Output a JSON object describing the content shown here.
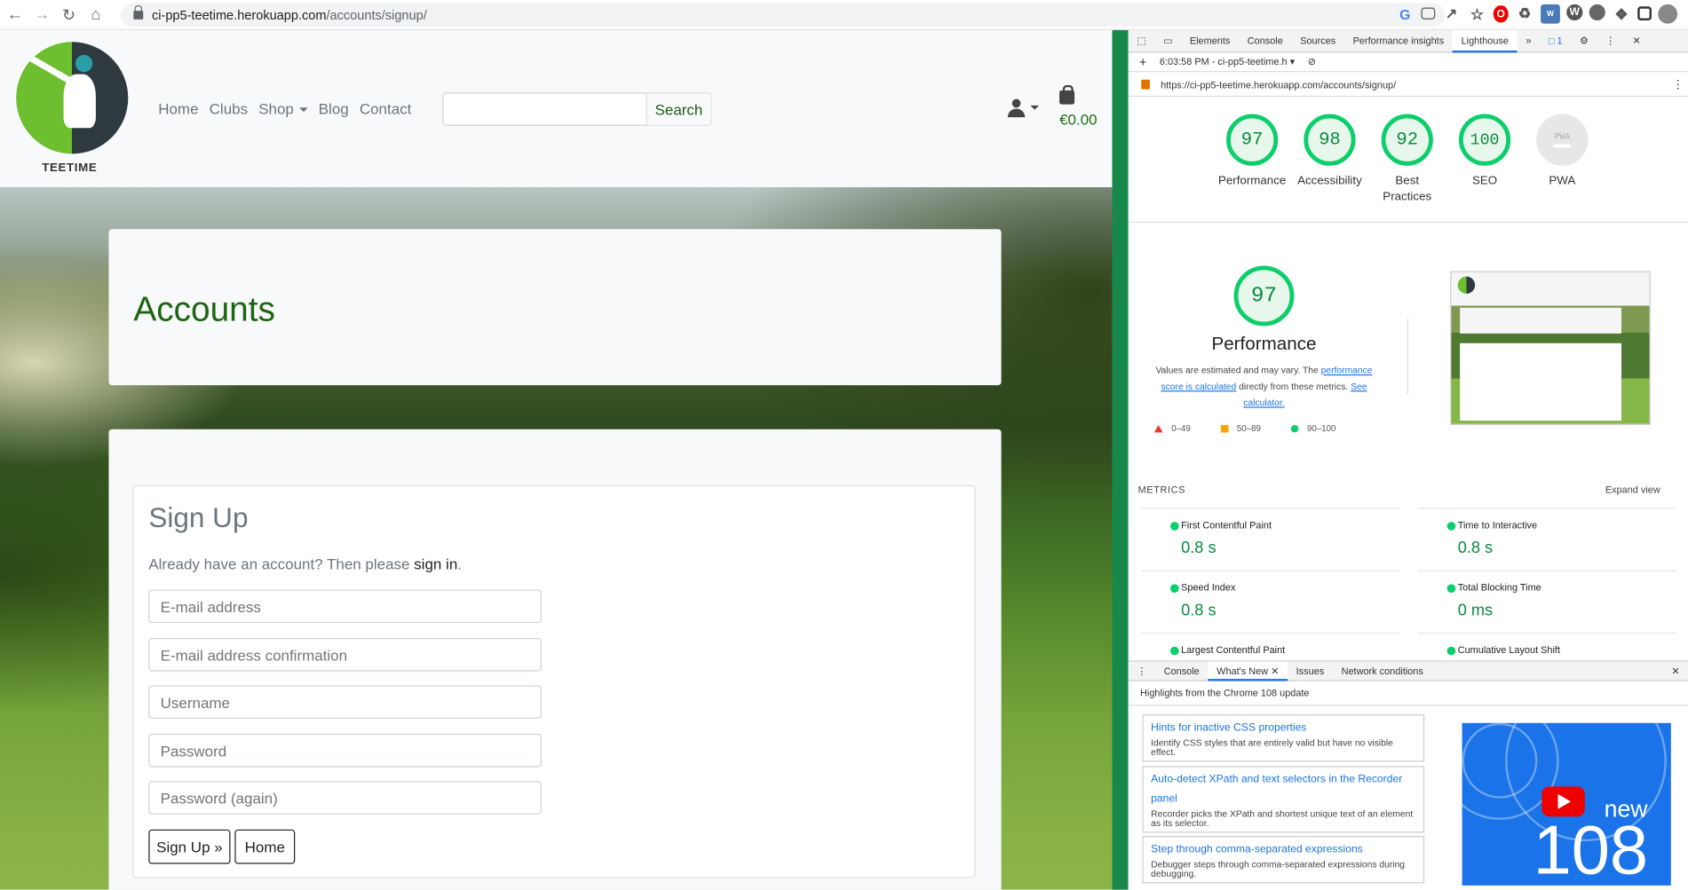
{
  "browser": {
    "url_host": "ci-pp5-teetime.herokuapp.com",
    "url_path": "/accounts/signup/"
  },
  "site": {
    "logo_text": "TEETIME",
    "nav": [
      "Home",
      "Clubs",
      "Shop",
      "Blog",
      "Contact"
    ],
    "search_button": "Search",
    "bag_total": "€0.00",
    "header_title": "Accounts",
    "form": {
      "title": "Sign Up",
      "prompt": "Already have an account? Then please ",
      "signin_link": "sign in",
      "prompt_end": ".",
      "fields": [
        "E-mail address",
        "E-mail address confirmation",
        "Username",
        "Password",
        "Password (again)"
      ],
      "signup_button": "Sign Up »",
      "home_button": "Home"
    }
  },
  "devtools": {
    "tabs": [
      "Elements",
      "Console",
      "Sources",
      "Performance insights",
      "Lighthouse"
    ],
    "active_tab": "Lighthouse",
    "issues_badge": "1",
    "report_selector": "6:03:58 PM - ci-pp5-teetime.h",
    "report_url": "https://ci-pp5-teetime.herokuapp.com/accounts/signup/",
    "scores": [
      {
        "value": "97",
        "label": "Performance"
      },
      {
        "value": "98",
        "label": "Accessibility"
      },
      {
        "value": "92",
        "label": "Best Practices"
      },
      {
        "value": "100",
        "label": "SEO"
      },
      {
        "value": "",
        "label": "PWA"
      }
    ],
    "pwa_badge": "PWA",
    "big_score": "97",
    "big_label": "Performance",
    "desc_1": "Values are estimated and may vary. The ",
    "desc_link": "performance score is calculated",
    "desc_2": " directly from these metrics. ",
    "desc_link2": "See calculator.",
    "legend": [
      "0–49",
      "50–89",
      "90–100"
    ],
    "metrics_heading": "METRICS",
    "expand": "Expand view",
    "metrics": [
      {
        "name": "First Contentful Paint",
        "value": "0.8 s"
      },
      {
        "name": "Time to Interactive",
        "value": "0.8 s"
      },
      {
        "name": "Speed Index",
        "value": "0.8 s"
      },
      {
        "name": "Total Blocking Time",
        "value": "0 ms"
      },
      {
        "name": "Largest Contentful Paint",
        "value": ""
      },
      {
        "name": "Cumulative Layout Shift",
        "value": ""
      }
    ],
    "drawer_tabs": [
      "Console",
      "What's New",
      "Issues",
      "Network conditions"
    ],
    "drawer_heading": "Highlights from the Chrome 108 update",
    "whats_new": [
      {
        "title": "Hints for inactive CSS properties",
        "desc": "Identify CSS styles that are entirely valid but have no visible effect."
      },
      {
        "title": "Auto-detect XPath and text selectors in the Recorder panel",
        "desc": "Recorder picks the XPath and shortest unique text of an element as its selector."
      },
      {
        "title": "Step through comma-separated expressions",
        "desc": "Debugger steps through comma-separated expressions during debugging."
      }
    ],
    "video_new": "new",
    "video_num": "108"
  },
  "colors": {
    "brand_green": "#1d6512",
    "lighthouse_green": "#0cce6b",
    "devtools_blue": "#1a73e8"
  }
}
